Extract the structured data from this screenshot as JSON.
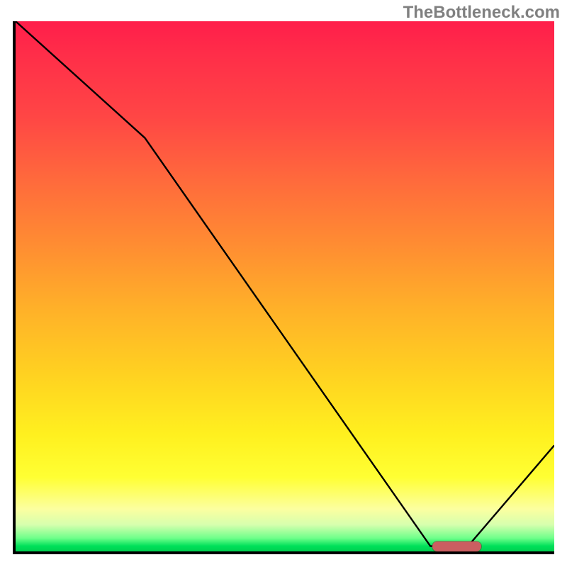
{
  "watermark": "TheBottleneck.com",
  "colors": {
    "axis": "#000000",
    "curve": "#000000",
    "marker": "#cb5e61",
    "watermark": "#808080"
  },
  "chart_data": {
    "type": "line",
    "title": "",
    "xlabel": "",
    "ylabel": "",
    "xlim": [
      0,
      100
    ],
    "ylim": [
      0,
      100
    ],
    "x": [
      0,
      24,
      77,
      84,
      100
    ],
    "values": [
      100,
      78,
      1,
      1,
      20
    ],
    "marker": {
      "x_start": 77,
      "x_end": 86,
      "y": 1
    },
    "grid": false,
    "legend": false
  }
}
